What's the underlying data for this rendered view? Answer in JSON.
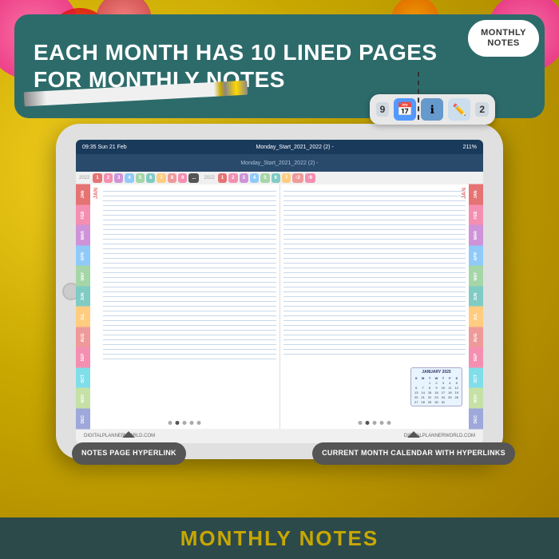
{
  "background": {
    "goldColor": "#c8a800"
  },
  "header": {
    "text_line1": "EACH MONTH HAS 10 LINED PAGES",
    "text_line2": "FOR MONTHLY NOTES",
    "bg_color": "#2d6b6b"
  },
  "monthly_notes_bubble": {
    "text": "MONTHLY\nNOTES"
  },
  "ipad": {
    "statusbar": {
      "left": "09:35  Sun 21 Feb",
      "center": "Monday_Start_2021_2022 (2) -",
      "right": "211%"
    },
    "toolbar_text": "Monday_Start_2021_2022 (2) -"
  },
  "months": [
    {
      "label": "JAN",
      "color": "#e57373"
    },
    {
      "label": "FEB",
      "color": "#f48fb1"
    },
    {
      "label": "MAR",
      "color": "#ce93d8"
    },
    {
      "label": "APR",
      "color": "#90caf9"
    },
    {
      "label": "MAY",
      "color": "#a5d6a7"
    },
    {
      "label": "JUN",
      "color": "#80cbc4"
    },
    {
      "label": "JUL",
      "color": "#ffcc80"
    },
    {
      "label": "AUG",
      "color": "#ef9a9a"
    },
    {
      "label": "SEP",
      "color": "#f48fb1"
    },
    {
      "label": "OCT",
      "color": "#80deea"
    },
    {
      "label": "NOV",
      "color": "#c5e1a5"
    },
    {
      "label": "DEC",
      "color": "#9fa8da"
    }
  ],
  "callout_notes": {
    "text": "NOTES\nPAGE\nHYPERLINK"
  },
  "callout_calendar": {
    "text": "CURRENT\nMONTH CALENDAR\nWITH HYPERLINKS"
  },
  "bottom_banner": {
    "text": "monthly Notes"
  },
  "mini_calendar": {
    "header": "JANUARY 2025",
    "days": [
      "S",
      "M",
      "T",
      "W",
      "T",
      "F",
      "S"
    ],
    "cells": [
      "",
      "",
      "1",
      "2",
      "3",
      "4",
      "5",
      "6",
      "7",
      "8",
      "9",
      "10",
      "11",
      "12",
      "13",
      "14",
      "15",
      "16",
      "17",
      "18",
      "19",
      "20",
      "21",
      "22",
      "23",
      "24",
      "25",
      "26",
      "27",
      "28",
      "29",
      "30",
      "31",
      "",
      ""
    ]
  }
}
